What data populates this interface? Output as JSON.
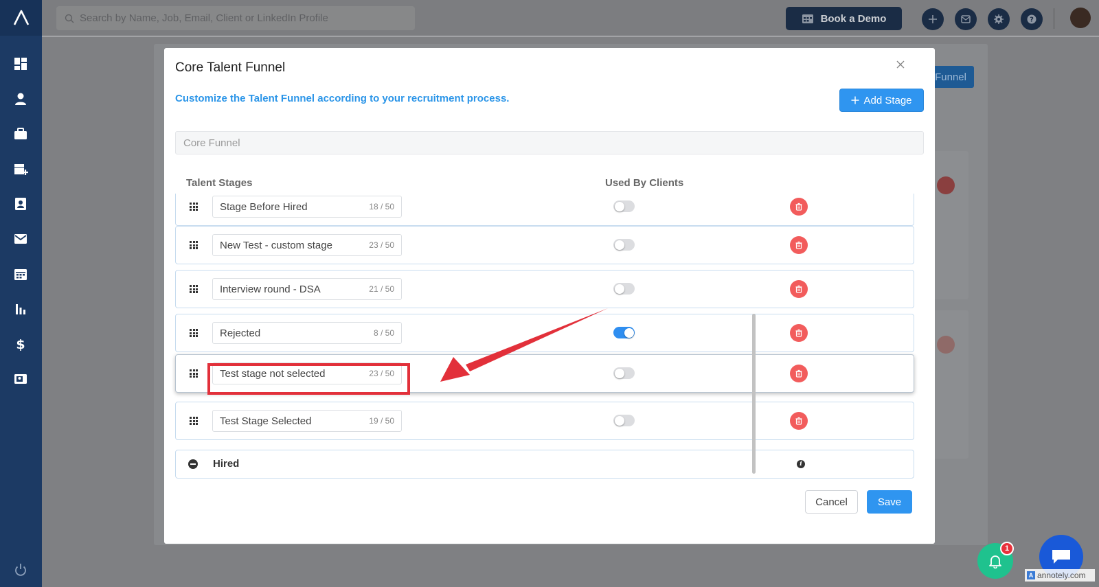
{
  "topbar": {
    "search_placeholder": "Search by Name, Job, Email, Client or LinkedIn Profile",
    "book_demo_label": "Book a Demo"
  },
  "sidebar": {
    "items": [
      "dashboard-icon",
      "candidates-icon",
      "jobs-icon",
      "clients-icon",
      "contacts-icon",
      "mail-icon",
      "calendar-icon",
      "reports-icon",
      "billing-icon",
      "media-icon"
    ]
  },
  "background": {
    "funnel_button_label": "Funnel"
  },
  "modal": {
    "title": "Core Talent Funnel",
    "subtitle": "Customize the Talent Funnel according to your recruitment process.",
    "add_stage_label": "Add Stage",
    "funnel_name": "Core Funnel",
    "col_stages": "Talent Stages",
    "col_clients": "Used By Clients",
    "stages": [
      {
        "name": "Stage Before Hired",
        "count": "18 / 50",
        "used_by_clients": false
      },
      {
        "name": "New Test - custom stage",
        "count": "23 / 50",
        "used_by_clients": false
      },
      {
        "name": "Interview round - DSA",
        "count": "21 / 50",
        "used_by_clients": false
      },
      {
        "name": "Rejected",
        "count": "8 / 50",
        "used_by_clients": true
      },
      {
        "name": "Test stage not selected",
        "count": "23 / 50",
        "used_by_clients": false
      },
      {
        "name": "Test Stage Selected",
        "count": "19 / 50",
        "used_by_clients": false
      }
    ],
    "hired_label": "Hired",
    "cancel_label": "Cancel",
    "save_label": "Save"
  },
  "widgets": {
    "notification_count": "1",
    "watermark": "annotely.com"
  },
  "colors": {
    "accent": "#2f95f0",
    "sidebar": "#1c3a64",
    "danger": "#f25c5c",
    "annotation": "#e2303a"
  }
}
